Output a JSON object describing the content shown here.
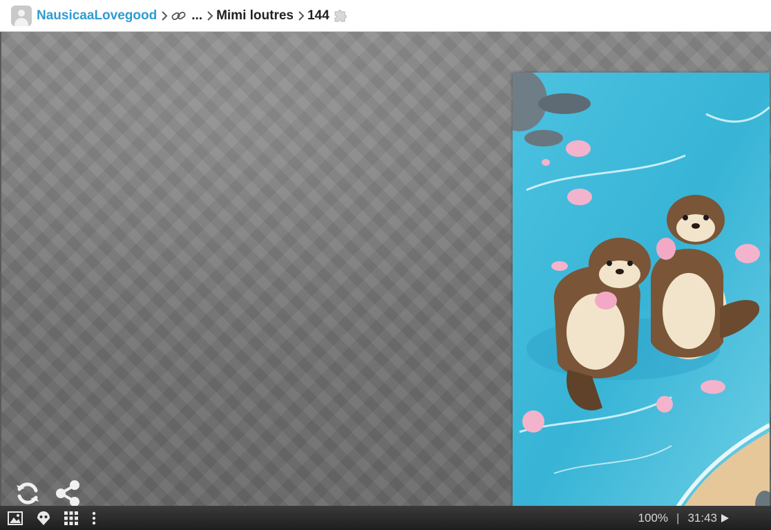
{
  "breadcrumb": {
    "user": "NausicaaLovegood",
    "ellipsis": "...",
    "puzzle_name": "Mimi loutres",
    "piece_count": "144"
  },
  "icons": {
    "separator": "chevron-right-icon",
    "link": "link-icon",
    "puzzle_piece": "puzzle-piece-icon",
    "restart": "restart-icon",
    "share": "share-icon",
    "image_preview": "image-icon",
    "ghost": "ghost-icon",
    "grid": "grid-icon",
    "menu": "more-vertical-icon",
    "play": "play-icon"
  },
  "status": {
    "zoom": "100%",
    "divider": "|",
    "timer": "31:43"
  },
  "colors": {
    "user_link": "#2e9bd1",
    "board": "#7d7d7d",
    "status_bar": "#1e1e1e",
    "water": "#39b6d6"
  }
}
